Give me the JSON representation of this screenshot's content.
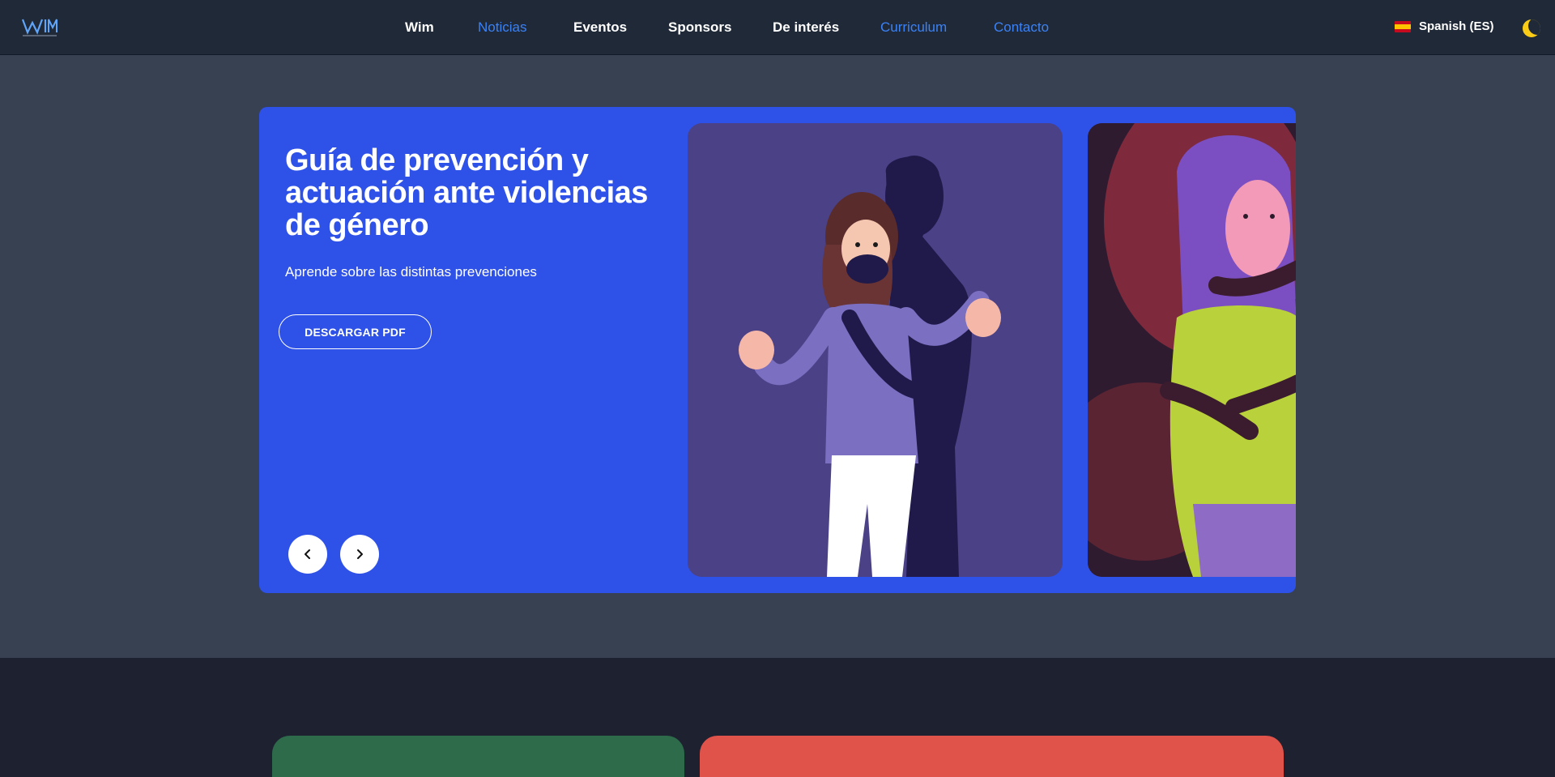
{
  "navbar": {
    "logo_text": "WIM",
    "links": [
      {
        "label": "Wim"
      },
      {
        "label": "Noticias"
      },
      {
        "label": "Eventos"
      },
      {
        "label": "Sponsors"
      },
      {
        "label": "De interés"
      },
      {
        "label": "Curriculum"
      },
      {
        "label": "Contacto"
      }
    ],
    "language": {
      "label": "Spanish (ES)",
      "flag": "spain-flag-icon"
    },
    "theme_toggle_icon": "moon-icon"
  },
  "hero": {
    "title": "Guía de prevención y actuación ante violencias de género",
    "subtitle": "Aprende sobre las distintas prevenciones",
    "download_label": "DESCARGAR PDF",
    "prev_icon": "chevron-left-icon",
    "next_icon": "chevron-right-icon"
  },
  "colors": {
    "page_bg": "#374151",
    "navbar_bg": "#1f2937",
    "hero_bg": "#2e51e8",
    "accent_link": "#3b82f6",
    "card_green": "#2d6b4b",
    "card_red": "#e0534a"
  }
}
